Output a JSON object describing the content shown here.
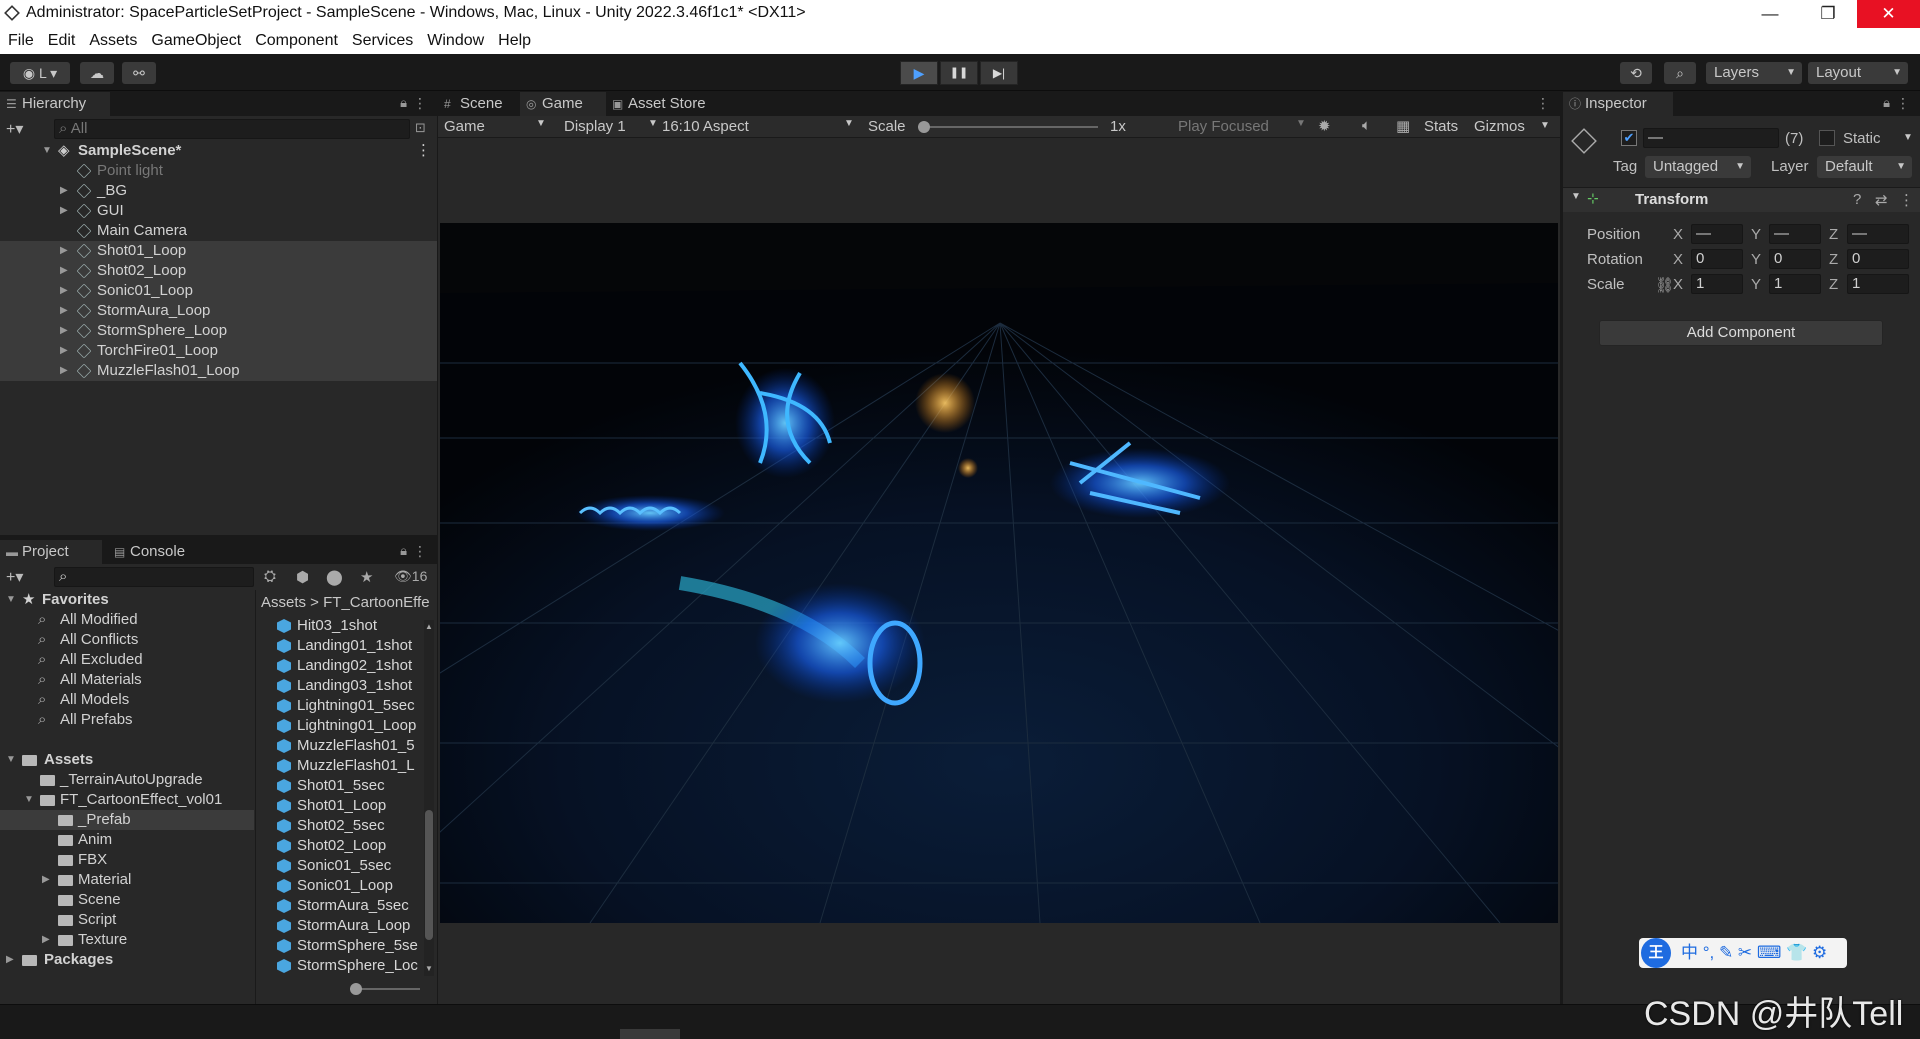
{
  "window": {
    "title": "Administrator: SpaceParticleSetProject - SampleScene - Windows, Mac, Linux - Unity 2022.3.46f1c1* <DX11>",
    "minimize": "—",
    "restore": "❐",
    "close": "✕"
  },
  "menu": [
    "File",
    "Edit",
    "Assets",
    "GameObject",
    "Component",
    "Services",
    "Window",
    "Help"
  ],
  "toolbar": {
    "account": "L",
    "layers": "Layers",
    "layout": "Layout",
    "play": "▶",
    "pause": "❚❚",
    "step": "▶|"
  },
  "hierarchy": {
    "tab": "Hierarchy",
    "search_placeholder": "All",
    "scene": "SampleScene*",
    "items": [
      "Point light",
      "_BG",
      "GUI",
      "Main Camera",
      "Shot01_Loop",
      "Shot02_Loop",
      "Sonic01_Loop",
      "StormAura_Loop",
      "StormSphere_Loop",
      "TorchFire01_Loop",
      "MuzzleFlash01_Loop"
    ]
  },
  "viewTabs": {
    "scene": "Scene",
    "game": "Game",
    "store": "Asset Store"
  },
  "gameBar": {
    "mode": "Game",
    "display": "Display 1",
    "aspect": "16:10 Aspect",
    "scale_label": "Scale",
    "scale_value": "1x",
    "play_focused": "Play Focused",
    "stats": "Stats",
    "gizmos": "Gizmos"
  },
  "project": {
    "tab": "Project",
    "console": "Console",
    "hidden_count": "16",
    "favorites_title": "Favorites",
    "favorites": [
      "All Modified",
      "All Conflicts",
      "All Excluded",
      "All Materials",
      "All Models",
      "All Prefabs"
    ],
    "assets_title": "Assets",
    "folders": [
      "_TerrainAutoUpgrade",
      "FT_CartoonEffect_vol01",
      "_Prefab",
      "Anim",
      "FBX",
      "Material",
      "Scene",
      "Script",
      "Texture"
    ],
    "packages": "Packages",
    "breadcrumb": [
      "Assets",
      "FT_CartoonEffe"
    ],
    "assets": [
      "Hit03_1shot",
      "Landing01_1shot",
      "Landing02_1shot",
      "Landing03_1shot",
      "Lightning01_5sec",
      "Lightning01_Loop",
      "MuzzleFlash01_5",
      "MuzzleFlash01_L",
      "Shot01_5sec",
      "Shot01_Loop",
      "Shot02_5sec",
      "Shot02_Loop",
      "Sonic01_5sec",
      "Sonic01_Loop",
      "StormAura_5sec",
      "StormAura_Loop",
      "StormSphere_5se",
      "StormSphere_Loc"
    ]
  },
  "inspector": {
    "tab": "Inspector",
    "name": "—",
    "count": "(7)",
    "static": "Static",
    "tag_label": "Tag",
    "tag": "Untagged",
    "layer_label": "Layer",
    "layer": "Default",
    "transform": "Transform",
    "position_label": "Position",
    "rotation_label": "Rotation",
    "scale_label": "Scale",
    "position": {
      "x": "—",
      "y": "—",
      "z": "—"
    },
    "rotation": {
      "x": "0",
      "y": "0",
      "z": "0"
    },
    "scale": {
      "x": "1",
      "y": "1",
      "z": "1"
    },
    "x": "X",
    "y": "Y",
    "z": "Z",
    "add_component": "Add Component"
  },
  "ime": {
    "chars": "中 °, ✎ ✂ ⌨ 👕 ⚙",
    "badge": "王"
  },
  "watermark": "CSDN @井队Tell"
}
